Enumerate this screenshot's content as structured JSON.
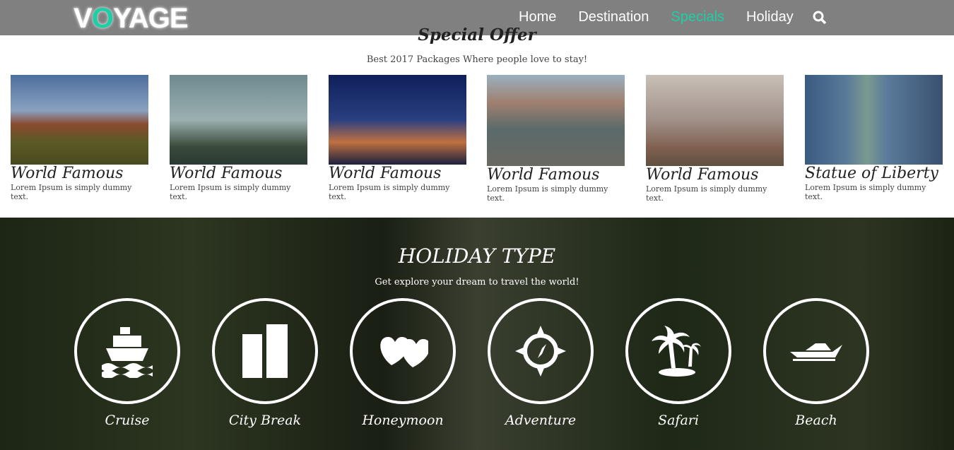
{
  "nav": {
    "logo": "VOYAGE",
    "logo_accent_letter": "O",
    "accent": "#1ccfa6",
    "items": [
      {
        "label": "Home"
      },
      {
        "label": "Destination"
      },
      {
        "label": "Specials",
        "active": true
      },
      {
        "label": "Holiday"
      }
    ],
    "search_icon": "search-icon"
  },
  "specials": {
    "title": "Special Offer",
    "subtitle": "Best 2017 Packages Where people love to stay!",
    "cards": [
      {
        "title": "World Famous",
        "desc": "Lorem Ipsum is simply dummy text."
      },
      {
        "title": "World Famous",
        "desc": "Lorem Ipsum is simply dummy text."
      },
      {
        "title": "World Famous",
        "desc": "Lorem Ipsum is simply dummy text."
      },
      {
        "title": "World Famous",
        "desc": "Lorem Ipsum is simply dummy text."
      },
      {
        "title": "World Famous",
        "desc": "Lorem Ipsum is simply dummy text."
      },
      {
        "title": "Statue of Liberty",
        "desc": "Lorem Ipsum is simply dummy text."
      }
    ]
  },
  "holiday": {
    "title": "HOLIDAY TYPE",
    "subtitle": "Get explore your dream to travel the world!",
    "types": [
      {
        "label": "Cruise",
        "icon": "ship-icon"
      },
      {
        "label": "City Break",
        "icon": "buildings-icon"
      },
      {
        "label": "Honeymoon",
        "icon": "hearts-icon"
      },
      {
        "label": "Adventure",
        "icon": "compass-icon"
      },
      {
        "label": "Safari",
        "icon": "palm-tree-icon"
      },
      {
        "label": "Beach",
        "icon": "speedboat-icon"
      }
    ]
  }
}
